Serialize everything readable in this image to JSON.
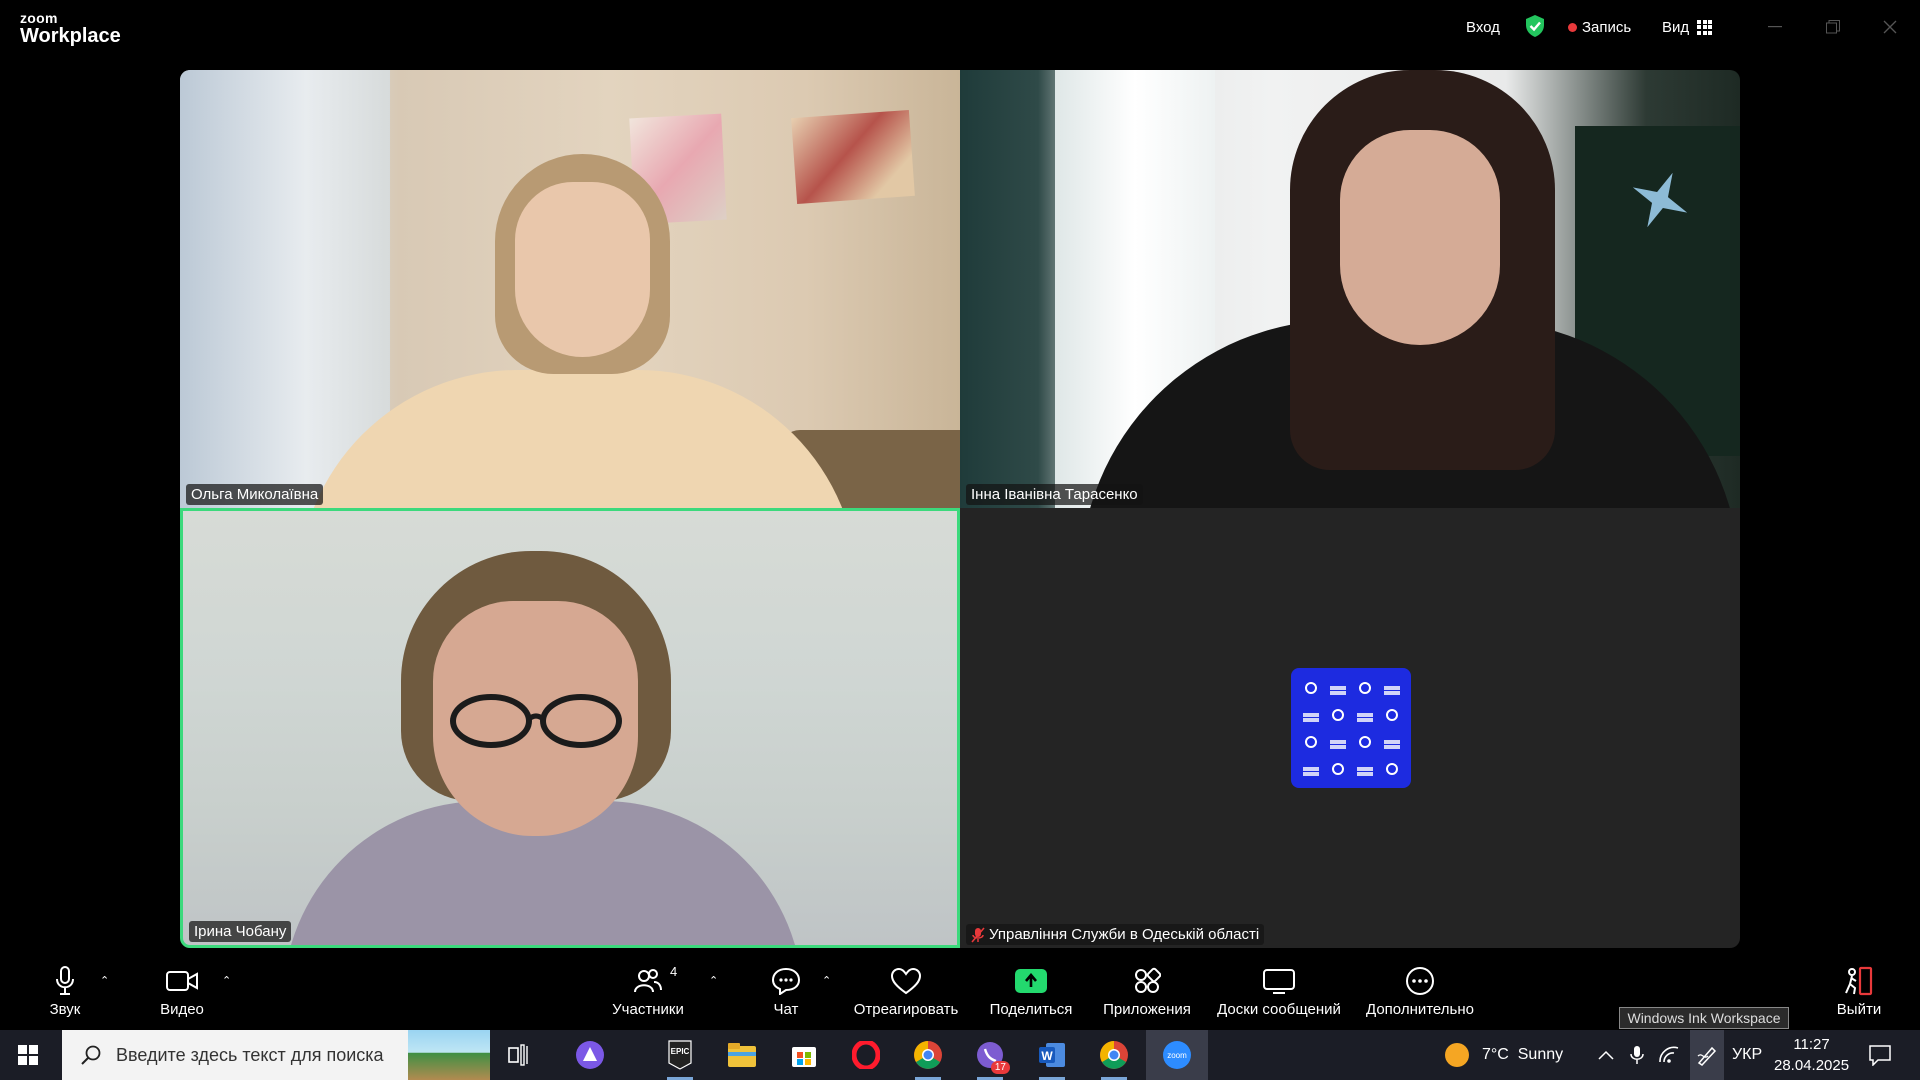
{
  "app": {
    "logo_top": "zoom",
    "logo_bottom": "Workplace",
    "login_label": "Вход",
    "record_label": "Запись",
    "view_label": "Вид"
  },
  "tiles": [
    {
      "name": "Ольга Миколаївна",
      "muted": false,
      "active_speaker": false
    },
    {
      "name": "Інна Іванівна Тарасенко",
      "muted": false,
      "active_speaker": false
    },
    {
      "name": "Ірина Чобану",
      "muted": false,
      "active_speaker": true
    },
    {
      "name": "Управління Служби в Одеській області",
      "muted": true,
      "active_speaker": false,
      "avatar": "organization-logo"
    }
  ],
  "controls": {
    "audio": "Звук",
    "video": "Видео",
    "participants": "Участники",
    "participants_count": "4",
    "chat": "Чат",
    "react": "Отреагировать",
    "share": "Поделиться",
    "apps": "Приложения",
    "whiteboards": "Доски сообщений",
    "more": "Дополнительно",
    "leave": "Выйти"
  },
  "tooltip": "Windows Ink Workspace",
  "taskbar": {
    "search_placeholder": "Введите здесь текст для поиска",
    "apps": [
      "task-view",
      "app-purple",
      "epic-games",
      "file-explorer",
      "microsoft-store",
      "opera",
      "chrome",
      "viber",
      "word",
      "chrome-profile",
      "zoom"
    ],
    "viber_badge": "17",
    "weather": "7°C  Sunny",
    "language": "УКР",
    "time": "11:27",
    "date": "28.04.2025"
  },
  "colors": {
    "active_speaker": "#3cd97c",
    "share": "#23d96e",
    "record_dot": "#e8393b",
    "org_logo": "#1d2be0"
  }
}
